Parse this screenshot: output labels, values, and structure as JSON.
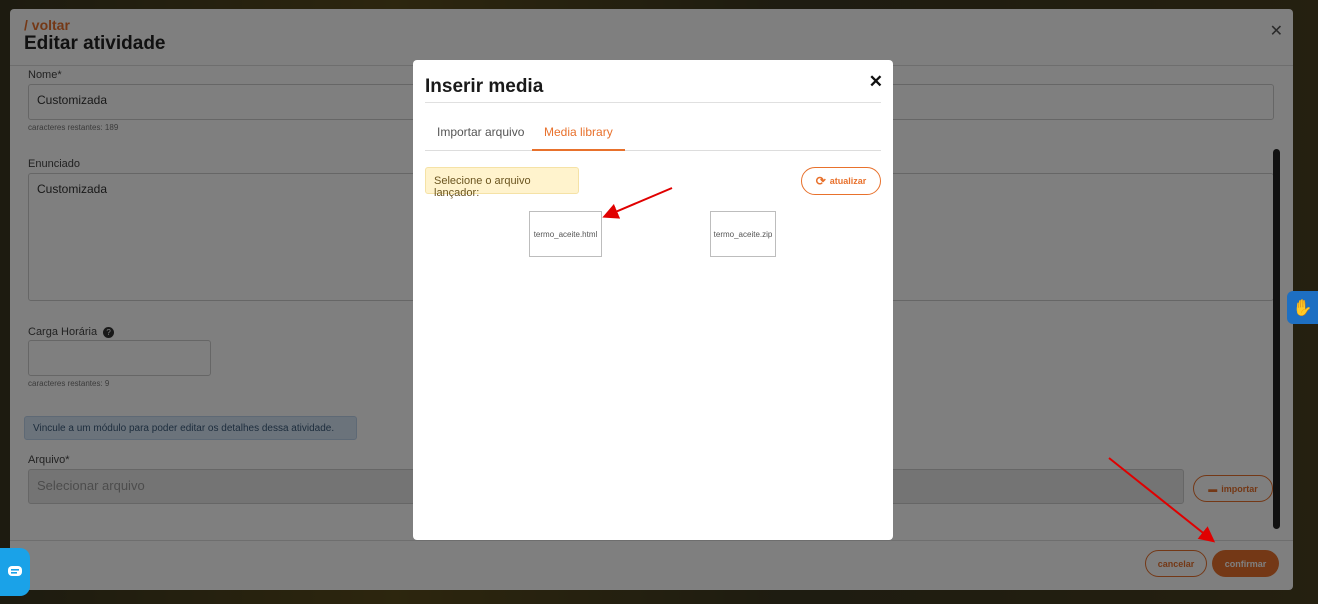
{
  "edit_panel": {
    "back_link": "/ voltar",
    "title": "Editar atividade",
    "nome_label": "Nome*",
    "nome_value": "Customizada",
    "nome_hint": "caracteres restantes: 189",
    "enunciado_label": "Enunciado",
    "enunciado_value": "Customizada",
    "carga_label": "Carga Horária",
    "carga_hint": "caracteres restantes: 9",
    "info_text": "Vincule a um módulo para poder editar os detalhes dessa atividade.",
    "arquivo_label": "Arquivo*",
    "arquivo_placeholder": "Selecionar arquivo",
    "importar_label": "importar",
    "cancelar_label": "cancelar",
    "confirmar_label": "confirmar"
  },
  "modal": {
    "title": "Inserir media",
    "tabs": [
      {
        "label": "Importar arquivo",
        "active": false
      },
      {
        "label": "Media library",
        "active": true
      }
    ],
    "notice": "Selecione o arquivo lançador:",
    "refresh_label": "atualizar",
    "files": [
      {
        "name": "termo_aceite.html"
      },
      {
        "name": "termo_aceite.zip"
      }
    ]
  },
  "icons": {
    "close": "close-icon",
    "help": "question-circle-icon",
    "folder": "folder-open-icon",
    "refresh": "refresh-icon",
    "accessibility": "sign-language-icon",
    "chat": "chat-icon"
  },
  "colors": {
    "accent": "#e8712c",
    "annotation": "#e00000",
    "info_bg": "#d6e6f7",
    "notice_bg": "#fff3cd"
  }
}
